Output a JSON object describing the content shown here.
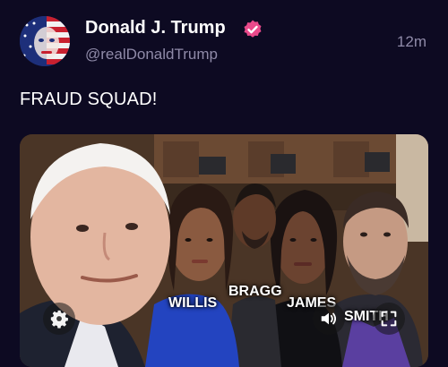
{
  "post": {
    "display_name": "Donald J. Trump",
    "handle": "@realDonaldTrump",
    "timestamp": "12m",
    "text": "FRAUD SQUAD!",
    "verified_color": "#e94a8b"
  },
  "media": {
    "labels": {
      "willis": "WILLIS",
      "bragg": "BRAGG",
      "james": "JAMES",
      "smith": "SMITH"
    },
    "controls": [
      "settings-icon",
      "volume-icon",
      "fullscreen-icon"
    ]
  },
  "colors": {
    "background": "#0d0a22",
    "secondary_text": "#8f8aa8"
  }
}
